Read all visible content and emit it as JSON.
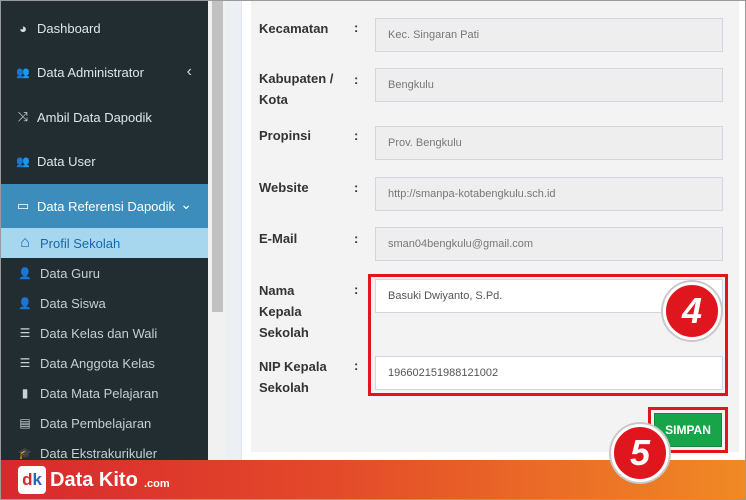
{
  "sidebar": {
    "menu": [
      {
        "icon": "dashboard-icon",
        "glyph": "◕",
        "label": "Dashboard"
      },
      {
        "icon": "users-icon",
        "glyph": "👥",
        "label": "Data Administrator",
        "chevron": "‹"
      },
      {
        "icon": "shuffle-icon",
        "glyph": "⤨",
        "label": "Ambil Data Dapodik"
      },
      {
        "icon": "user-group-icon",
        "glyph": "👥",
        "label": "Data User"
      },
      {
        "icon": "monitor-icon",
        "glyph": "▭",
        "label": "Data Referensi Dapodik",
        "chevron": "⌄"
      }
    ],
    "submenu": [
      {
        "icon": "home-icon",
        "glyph": "⌂",
        "label": "Profil Sekolah"
      },
      {
        "icon": "user-icon",
        "glyph": "👤",
        "label": "Data Guru"
      },
      {
        "icon": "user-icon",
        "glyph": "👤",
        "label": "Data Siswa"
      },
      {
        "icon": "list-icon",
        "glyph": "☰",
        "label": "Data Kelas dan Wali"
      },
      {
        "icon": "list-icon",
        "glyph": "☰",
        "label": "Data Anggota Kelas"
      },
      {
        "icon": "book-icon",
        "glyph": "▮",
        "label": "Data Mata Pelajaran"
      },
      {
        "icon": "table-icon",
        "glyph": "▤",
        "label": "Data Pembelajaran"
      },
      {
        "icon": "graduation-cap-icon",
        "glyph": "🎓",
        "label": "Data Ekstrakurikuler"
      }
    ]
  },
  "form": {
    "separator": ":",
    "fields": [
      {
        "label": "Kecamatan",
        "value": "Kec. Singaran Pati"
      },
      {
        "label": "Kabupaten / Kota",
        "value": "Bengkulu"
      },
      {
        "label": "Propinsi",
        "value": "Prov. Bengkulu"
      },
      {
        "label": "Website",
        "value": "http://smanpa-kotabengkulu.sch.id"
      },
      {
        "label": "E-Mail",
        "value": "sman04bengkulu@gmail.com"
      },
      {
        "label": "Nama Kepala Sekolah",
        "value": "Basuki Dwiyanto, S.Pd."
      },
      {
        "label": "NIP Kepala Sekolah",
        "value": "196602151988121002"
      }
    ],
    "save_label": "SIMPAN"
  },
  "annotations": {
    "step4": "4",
    "step5": "5"
  },
  "brand": {
    "name": "Data Kito",
    "domain": ".com",
    "logo_d": "d",
    "logo_k": "k"
  },
  "colors": {
    "sidebar": "#222d32",
    "active": "#3c8dbc",
    "save": "#18a54a",
    "highlight": "#e3141c"
  }
}
